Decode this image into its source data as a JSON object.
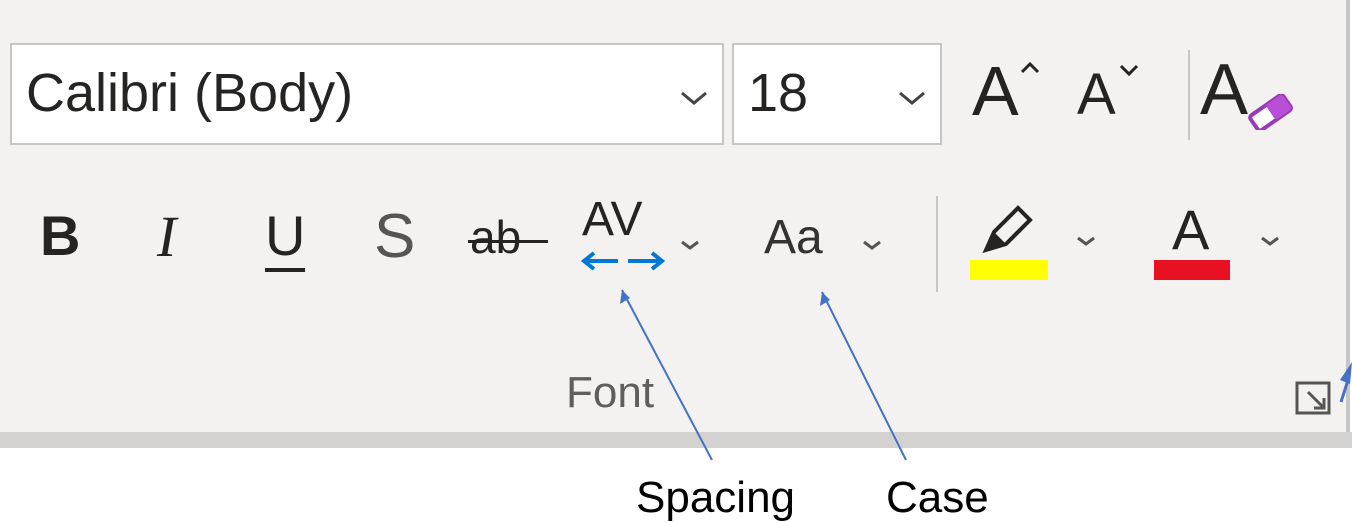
{
  "font_group": {
    "label": "Font",
    "font_name": "Calibri (Body)",
    "font_size": "18",
    "bold_label": "B",
    "italic_label": "I",
    "underline_label": "U",
    "shadow_label": "S",
    "strikethrough_label": "ab",
    "spacing_label": "AV",
    "case_label": "Aa",
    "grow_label": "A",
    "shrink_label": "A",
    "clear_label": "A",
    "font_color_label": "A",
    "highlight_color": "#ffff00",
    "font_color": "#e81123",
    "spacing_arrow_color": "#0078d4"
  },
  "annotations": {
    "spacing": "Spacing",
    "case": "Case"
  }
}
